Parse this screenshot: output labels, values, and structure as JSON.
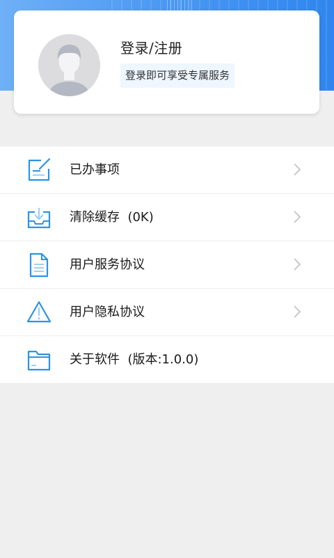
{
  "profile": {
    "login_title": "登录/注册",
    "login_subtitle": "登录即可享受专属服务"
  },
  "menu": {
    "items": [
      {
        "label": "已办事项",
        "icon": "edit-icon",
        "has_chevron": true
      },
      {
        "label": "清除缓存  (0K)",
        "icon": "inbox-download-icon",
        "has_chevron": true
      },
      {
        "label": "用户服务协议",
        "icon": "document-icon",
        "has_chevron": true
      },
      {
        "label": "用户隐私协议",
        "icon": "warning-icon",
        "has_chevron": true
      },
      {
        "label": "关于软件  (版本:1.0.0)",
        "icon": "folder-icon",
        "has_chevron": false
      }
    ]
  },
  "colors": {
    "accent": "#2a93e8",
    "header_gradient_start": "#6fb0f7",
    "header_gradient_end": "#2f86ee",
    "page_background": "#efefef"
  }
}
